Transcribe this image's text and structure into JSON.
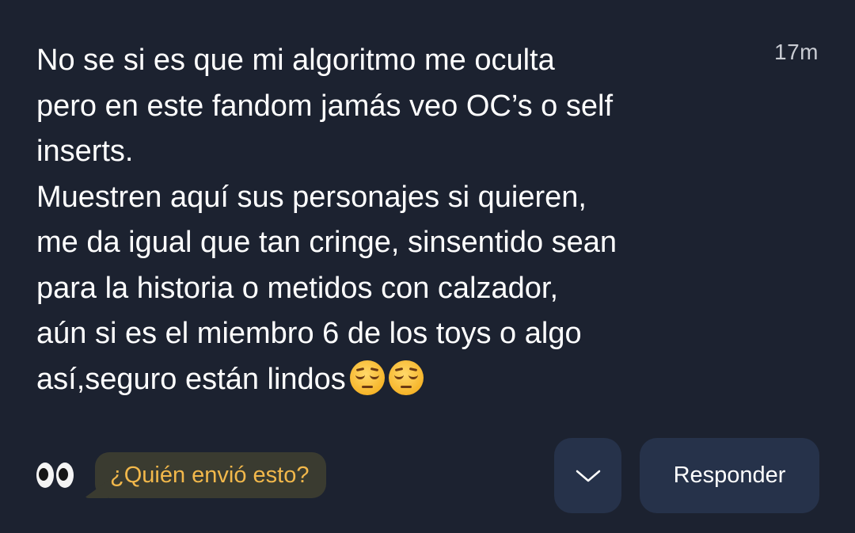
{
  "message": {
    "timestamp": "17m",
    "lines": [
      "No se si es que mi algoritmo me oculta",
      "pero en este fandom jamás veo OC’s o self",
      "inserts.",
      "Muestren aquí sus personajes si quieren,",
      "me da igual que tan cringe, sinsentido sean",
      "para la historia o metidos con calzador,",
      "aún si es el miembro 6 de los toys o algo",
      "así,seguro están lindos"
    ],
    "trailing_emojis": [
      "pensive-face-icon",
      "pensive-face-icon"
    ]
  },
  "footer": {
    "eyes_icon": "eyes-icon",
    "who_sent_label": "¿Quién envió esto?",
    "chevron_icon": "chevron-down-icon",
    "reply_label": "Responder"
  },
  "colors": {
    "background": "#1c2230",
    "button_bg": "#26324a",
    "bubble_bg": "#3a3b30",
    "bubble_text": "#f2b84b"
  }
}
